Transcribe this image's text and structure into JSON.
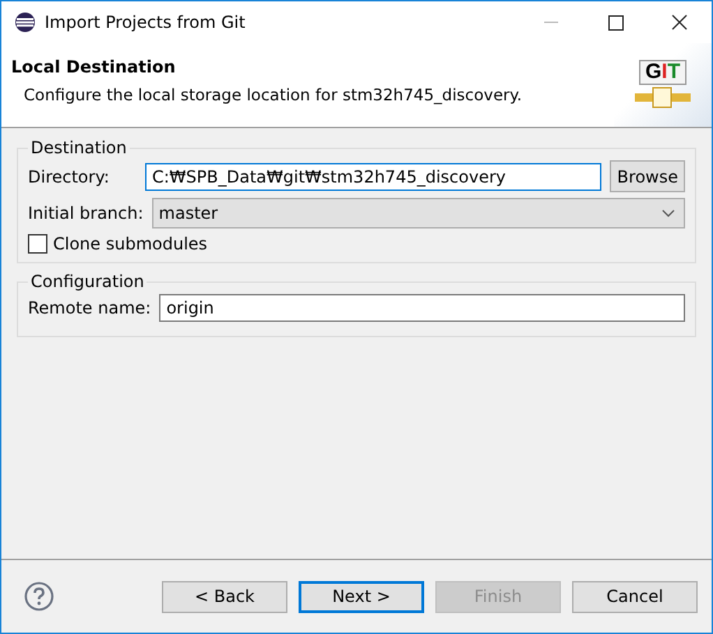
{
  "window": {
    "title": "Import Projects from Git"
  },
  "header": {
    "title": "Local Destination",
    "description": "Configure the local storage location for stm32h745_discovery.",
    "logo_text": "GIT"
  },
  "destination": {
    "legend": "Destination",
    "directory_label": "Directory:",
    "directory_value": "C:₩SPB_Data₩git₩stm32h745_discovery",
    "browse_button": "Browse",
    "branch_label": "Initial branch:",
    "branch_value": "master",
    "clone_submodules": {
      "label": "Clone submodules",
      "checked": false
    }
  },
  "configuration": {
    "legend": "Configuration",
    "remote_label": "Remote name:",
    "remote_value": "origin"
  },
  "buttons": [
    {
      "label": "< Back",
      "disabled": false,
      "default": false
    },
    {
      "label": "Next >",
      "disabled": false,
      "default": true
    },
    {
      "label": "Finish",
      "disabled": true,
      "default": false
    },
    {
      "label": "Cancel",
      "disabled": false,
      "default": false
    }
  ]
}
